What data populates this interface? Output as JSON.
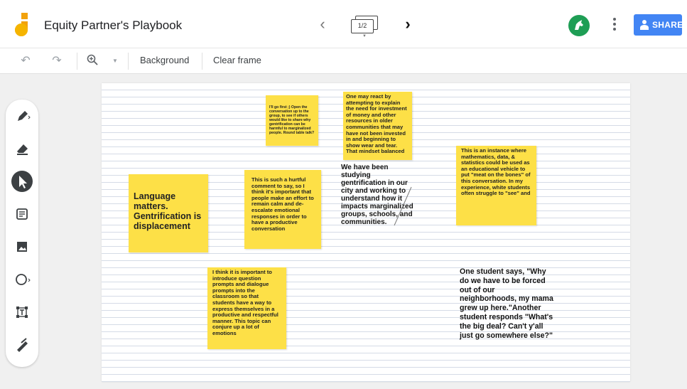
{
  "app": {
    "title": "Equity Partner's Playbook"
  },
  "nav": {
    "frame_label": "1/2"
  },
  "header": {
    "share_label": "SHARE"
  },
  "toolbar": {
    "background_label": "Background",
    "clear_frame_label": "Clear frame"
  },
  "colors": {
    "note": "#fde047",
    "share": "#4285f4",
    "avatar": "#1e9e55"
  },
  "notes": [
    {
      "text": "Language matters. Gentrification is displacement"
    },
    {
      "text": "I'll go first ;) Open the conversation up to the group, to see if others would like to share why gentrification can be harmful to marginalized people. Round table talk?"
    },
    {
      "text": "One may react by attempting to explain the need for investment of money and other resources in older communities that may have not been invested in and beginning to show wear and tear.  That mindset balanced"
    },
    {
      "text": "This is such a hurtful comment to say, so I think it's important that people make an effort to remain calm and de-escalate emotional responses in order to have a productive conversation"
    },
    {
      "text": "This is an instance where mathematics, data, & statistics could be used as an educational vehicle to put \"meat on the bones\" of this conversation. In my experience, white students often struggle to \"see\" and"
    },
    {
      "text": "I think it is important to introduce question prompts and dialogue prompts into the classroom so that students have a way to express themselves in a productive and respectful manner. This topic can conjure up a lot of emotions"
    }
  ],
  "texts": [
    {
      "text": "We have been studying gentrification in our city and working to understand how it impacts marginalized groups, schools, and communities."
    },
    {
      "text": "One student says, \"Why do we have to be forced out of our neighborhoods, my mama grew up here.\"Another student responds \"What's the big deal? Can't y'all just go somewhere else?\""
    }
  ]
}
